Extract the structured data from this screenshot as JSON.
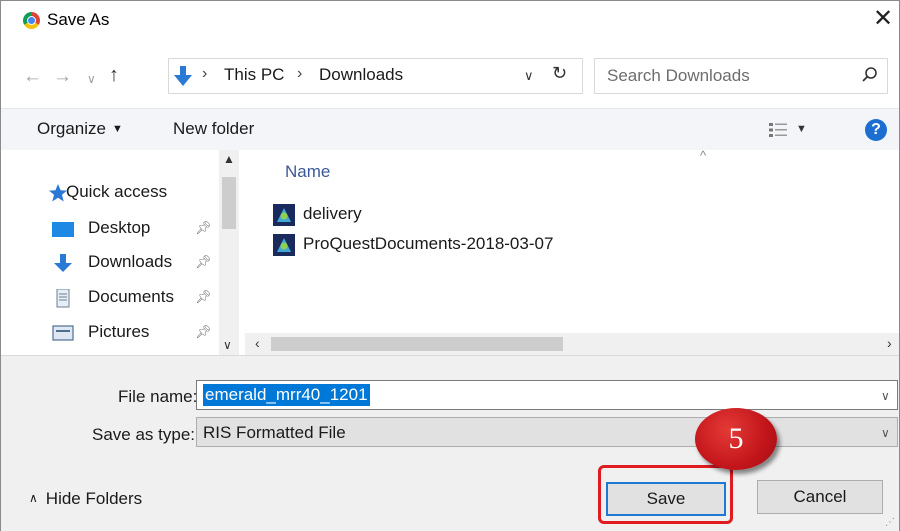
{
  "window": {
    "title": "Save As",
    "close_glyph": "✕",
    "app_icon": "chrome-icon"
  },
  "address_bar": {
    "path": [
      "This PC",
      "Downloads"
    ],
    "separator": "›",
    "location_icon": "download-arrow-icon"
  },
  "search": {
    "placeholder": "Search Downloads"
  },
  "toolbar": {
    "organize_label": "Organize",
    "new_folder_label": "New folder",
    "help_glyph": "?"
  },
  "nav_pane": {
    "items": [
      {
        "label": "Quick access",
        "icon": "star-icon",
        "pinned": false
      },
      {
        "label": "Desktop",
        "icon": "desktop-icon",
        "pinned": true
      },
      {
        "label": "Downloads",
        "icon": "download-arrow-icon",
        "pinned": true
      },
      {
        "label": "Documents",
        "icon": "document-icon",
        "pinned": true
      },
      {
        "label": "Pictures",
        "icon": "pictures-icon",
        "pinned": true
      }
    ]
  },
  "file_list": {
    "column_header": "Name",
    "files": [
      {
        "name": "delivery",
        "icon": "app-file-icon"
      },
      {
        "name": "ProQuestDocuments-2018-03-07",
        "icon": "app-file-icon"
      }
    ]
  },
  "form": {
    "file_name_label": "File name:",
    "file_name_value": "emerald_mrr40_1201",
    "save_type_label": "Save as type:",
    "save_type_value": "RIS Formatted File"
  },
  "footer": {
    "hide_folders_label": "Hide Folders",
    "save_label": "Save",
    "cancel_label": "Cancel"
  },
  "annotation": {
    "step_number": "5",
    "highlight_color": "#e11b22"
  },
  "colors": {
    "accent": "#0078d7",
    "help": "#1a6fd1",
    "badge": "#c2151b"
  }
}
